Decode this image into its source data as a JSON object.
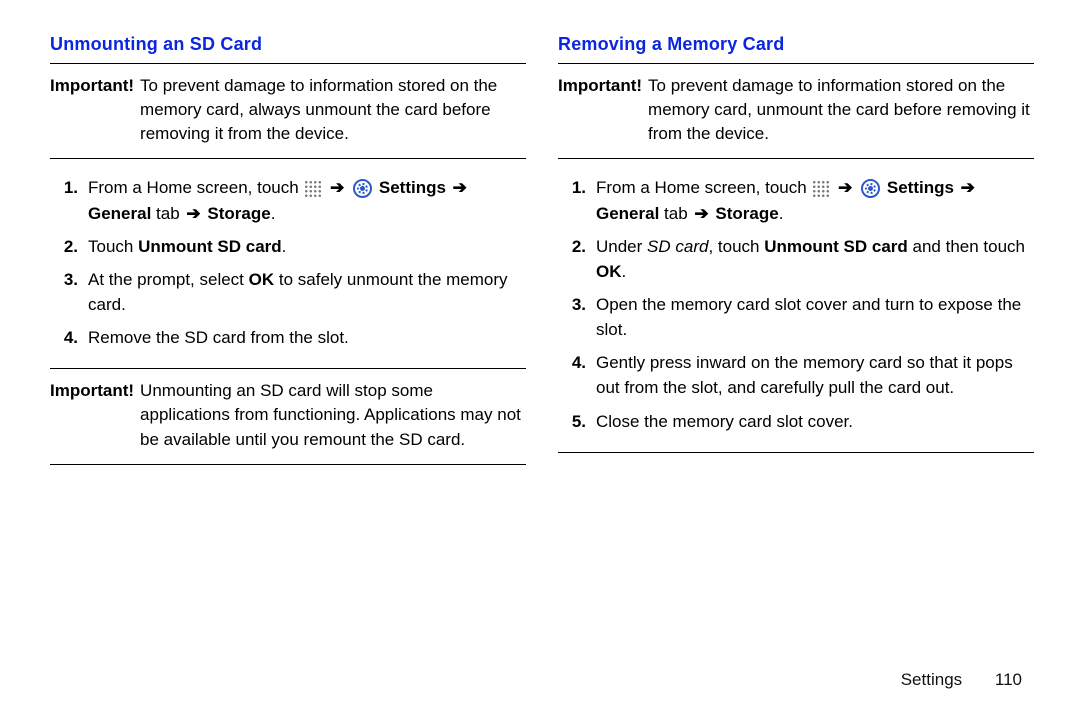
{
  "arrow": "➔",
  "left": {
    "title": "Unmounting an SD Card",
    "important_top_label": "Important!",
    "important_top_body": "To prevent damage to information stored on the memory card, always unmount the card before removing it from the device.",
    "steps": {
      "s1_prefix": "From a Home screen, touch ",
      "s1_settings": "Settings",
      "s1_general": "General",
      "s1_tab": " tab ",
      "s1_storage": "Storage",
      "s1_period": ".",
      "s2_pre": "Touch ",
      "s2_bold": "Unmount SD card",
      "s2_post": ".",
      "s3_pre": "At the prompt, select ",
      "s3_bold": "OK",
      "s3_post": " to safely unmount the memory card.",
      "s4": "Remove the SD card from the slot."
    },
    "important_bottom_label": "Important!",
    "important_bottom_body": "Unmounting an SD card will stop some applications from functioning. Applications may not be available until you remount the SD card."
  },
  "right": {
    "title": "Removing a Memory Card",
    "important_top_label": "Important!",
    "important_top_body": "To prevent damage to information stored on the memory card, unmount the card before removing it from the device.",
    "steps": {
      "s1_prefix": "From a Home screen, touch ",
      "s1_settings": "Settings",
      "s1_general": "General",
      "s1_tab": " tab ",
      "s1_storage": "Storage",
      "s1_period": ".",
      "s2_pre": "Under ",
      "s2_italic": "SD card",
      "s2_mid": ", touch ",
      "s2_bold1": "Unmount SD card",
      "s2_mid2": " and then touch ",
      "s2_bold2": "OK",
      "s2_post": ".",
      "s3": "Open the memory card slot cover and turn to expose the slot.",
      "s4": "Gently press inward on the memory card so that it pops out from the slot, and carefully pull the card out.",
      "s5": "Close the memory card slot cover."
    }
  },
  "footer": {
    "section": "Settings",
    "page": "110"
  },
  "step_numbers": {
    "n1": "1.",
    "n2": "2.",
    "n3": "3.",
    "n4": "4.",
    "n5": "5."
  }
}
